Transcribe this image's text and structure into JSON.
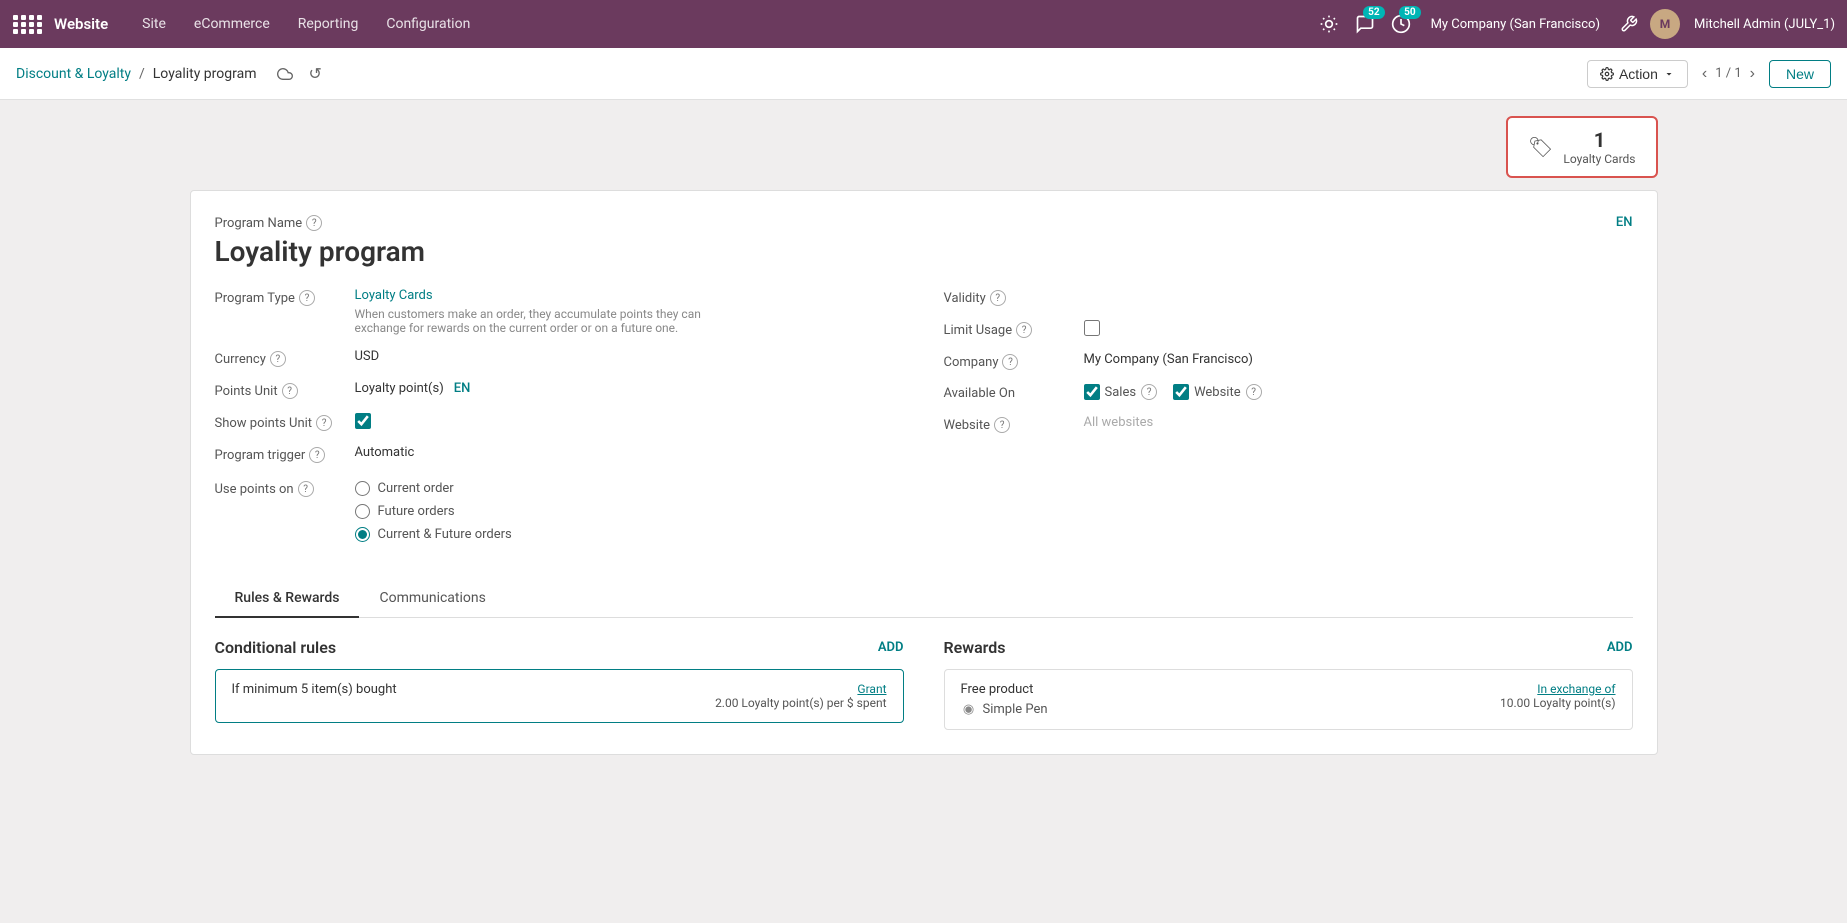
{
  "topnav": {
    "app_name": "Website",
    "nav_items": [
      "Site",
      "eCommerce",
      "Reporting",
      "Configuration"
    ],
    "company": "My Company (San Francisco)",
    "user": "Mitchell Admin (JULY_1)",
    "badge_messages": "52",
    "badge_clock": "50"
  },
  "breadcrumb": {
    "parent_label": "Discount & Loyalty",
    "separator": "/",
    "current_label": "Loyality program",
    "record_position": "1 / 1"
  },
  "toolbar": {
    "action_label": "Action",
    "new_label": "New"
  },
  "stat_card": {
    "count": "1",
    "label": "Loyalty Cards"
  },
  "form": {
    "program_name_label": "Program Name",
    "program_title": "Loyality program",
    "lang_badge": "EN",
    "program_type_label": "Program Type",
    "program_type_value": "Loyalty Cards",
    "program_type_desc": "When customers make an order, they accumulate points they can exchange for rewards on the current order or on a future one.",
    "currency_label": "Currency",
    "currency_value": "USD",
    "points_unit_label": "Points Unit",
    "points_unit_value": "Loyalty point(s)",
    "points_unit_lang": "EN",
    "show_points_label": "Show points Unit",
    "show_points_checked": true,
    "program_trigger_label": "Program trigger",
    "program_trigger_value": "Automatic",
    "use_points_label": "Use points on",
    "use_points_options": [
      "Current order",
      "Future orders",
      "Current & Future orders"
    ],
    "use_points_selected": 2,
    "validity_label": "Validity",
    "limit_usage_label": "Limit Usage",
    "company_label": "Company",
    "company_value": "My Company (San Francisco)",
    "available_on_label": "Available On",
    "available_on_sales": "Sales",
    "available_on_website": "Website",
    "website_label": "Website",
    "website_value": "All websites"
  },
  "tabs": {
    "items": [
      "Rules & Rewards",
      "Communications"
    ],
    "active": "Rules & Rewards"
  },
  "rules_section": {
    "title": "Conditional rules",
    "add_label": "ADD",
    "rule_text": "If minimum 5 item(s) bought",
    "rule_grant_label": "Grant",
    "rule_grant_value": "2.00 Loyalty point(s) per $ spent"
  },
  "rewards_section": {
    "title": "Rewards",
    "add_label": "ADD",
    "reward_name": "Free product",
    "reward_product_icon": "◉",
    "reward_product": "Simple Pen",
    "reward_exchange_label": "In exchange of",
    "reward_exchange_value": "10.00 Loyalty point(s)"
  }
}
